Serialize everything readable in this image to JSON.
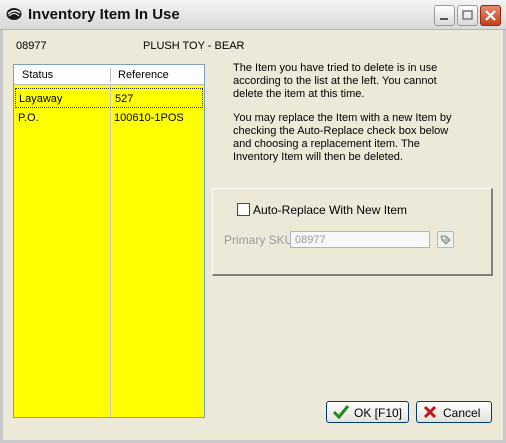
{
  "window": {
    "title": "Inventory Item In Use"
  },
  "item": {
    "sku": "08977",
    "name": "PLUSH TOY - BEAR"
  },
  "list": {
    "columns": [
      "Status",
      "Reference"
    ],
    "rows": [
      {
        "status": "Layaway",
        "reference": "527"
      },
      {
        "status": "P.O.",
        "reference": "100610-1POS"
      }
    ],
    "background": "#ffff00"
  },
  "message": {
    "line1": "The Item you have tried to delete is in use",
    "line2": "according to the list at the left.  You cannot",
    "line3": "delete the item at this time.",
    "line4": "You may replace the Item with a new Item by",
    "line5": "checking the Auto-Replace check box below",
    "line6": "and choosing a replacement item.  The",
    "line7": "Inventory Item will then be deleted."
  },
  "replace": {
    "checkbox_label": "Auto-Replace With New Item",
    "checked": false,
    "sku_label": "Primary SKU:",
    "sku_value": "08977"
  },
  "buttons": {
    "ok": "OK [F10]",
    "cancel": "Cancel"
  },
  "icons": [
    "app-logo-icon",
    "minimize-icon",
    "maximize-icon",
    "close-icon",
    "lookup-icon",
    "checkmark-icon",
    "x-icon"
  ]
}
